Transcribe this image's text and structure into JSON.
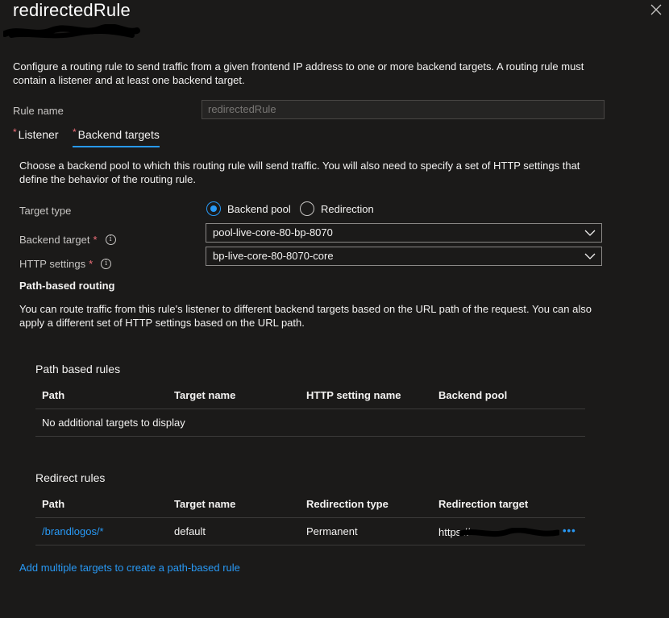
{
  "header": {
    "title": "redirectedRule"
  },
  "intro": "Configure a routing rule to send traffic from a given frontend IP address to one or more backend targets. A routing rule must contain a listener and at least one backend target.",
  "rule_name": {
    "label": "Rule name",
    "value": "redirectedRule"
  },
  "tabs": [
    {
      "label": "Listener",
      "required": "*"
    },
    {
      "label": "Backend targets",
      "required": "*",
      "active": true
    }
  ],
  "backend": {
    "description": "Choose a backend pool to which this routing rule will send traffic. You will also need to specify a set of HTTP settings that define the behavior of the routing rule.",
    "target_type_label": "Target type",
    "options": [
      "Backend pool",
      "Redirection"
    ],
    "selected": "Backend pool",
    "backend_target_label": "Backend target",
    "backend_target_value": "pool-live-core-80-bp-8070",
    "http_settings_label": "HTTP settings",
    "http_settings_value": "bp-live-core-80-8070-core",
    "required_mark": "*",
    "info_glyph": "i"
  },
  "path_routing": {
    "heading": "Path-based routing",
    "description": "You can route traffic from this rule's listener to different backend targets based on the URL path of the request. You can also apply a different set of HTTP settings based on the URL path."
  },
  "path_rules": {
    "title": "Path based rules",
    "columns": [
      "Path",
      "Target name",
      "HTTP setting name",
      "Backend pool"
    ],
    "empty_text": "No additional targets to display"
  },
  "redirect_rules": {
    "title": "Redirect rules",
    "columns": [
      "Path",
      "Target name",
      "Redirection type",
      "Redirection target"
    ],
    "rows": [
      {
        "path": "/brandlogos/*",
        "target_name": "default",
        "type": "Permanent",
        "target": "https://",
        "more": "•••"
      }
    ]
  },
  "footer_link": "Add multiple targets to create a path-based rule",
  "colors": {
    "background": "#1b1a19",
    "accent": "#2899f5",
    "required": "#f1707b"
  }
}
